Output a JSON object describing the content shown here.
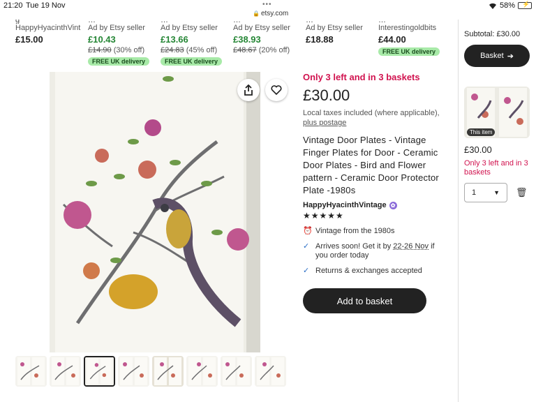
{
  "status": {
    "time": "21:20",
    "date": "Tue 19 Nov",
    "url": "etsy.com",
    "battery": "58%",
    "battery_level": 0.58
  },
  "ads": [
    {
      "cut": "g",
      "seller": "HappyHyacinthVint",
      "price": "£15.00",
      "green": false,
      "orig": "",
      "discount": "",
      "badge": ""
    },
    {
      "cut": "…",
      "seller": "Ad by Etsy seller",
      "price": "£10.43",
      "green": true,
      "orig": "£14.90",
      "discount": "(30% off)",
      "badge": "FREE UK delivery"
    },
    {
      "cut": "…",
      "seller": "Ad by Etsy seller",
      "price": "£13.66",
      "green": true,
      "orig": "£24.83",
      "discount": "(45% off)",
      "badge": "FREE UK delivery"
    },
    {
      "cut": "…",
      "seller": "Ad by Etsy seller",
      "price": "£38.93",
      "green": true,
      "orig": "£48.67",
      "discount": "(20% off)",
      "badge": ""
    },
    {
      "cut": "…",
      "seller": "Ad by Etsy seller",
      "price": "£18.88",
      "green": false,
      "orig": "",
      "discount": "",
      "badge": ""
    },
    {
      "cut": "…",
      "seller": "Interestingoldbits",
      "price": "£44.00",
      "green": false,
      "orig": "",
      "discount": "",
      "badge": "FREE UK delivery"
    }
  ],
  "product": {
    "urgency": "Only 3 left and in 3 baskets",
    "price": "£30.00",
    "taxes": "Local taxes included (where applicable),",
    "postage_link": "plus postage",
    "title": "Vintage Door Plates - Vintage Finger Plates for Door - Ceramic Door Plates - Bird and Flower pattern - Ceramic Door Protector Plate -1980s",
    "shop": "HappyHyacinthVintage",
    "rating_stars": "★★★★★",
    "features": [
      {
        "icon": "alarm-clock-icon",
        "text": "Vintage from the 1980s",
        "link": ""
      },
      {
        "icon": "check-icon",
        "text": "Arrives soon! Get it by ",
        "link": "22-26 Nov",
        "text2": " if you order today"
      },
      {
        "icon": "check-icon",
        "text": "Returns & exchanges accepted",
        "link": ""
      }
    ],
    "add_to_basket": "Add to basket"
  },
  "basket": {
    "subtotal": "Subtotal: £30.00",
    "basket_label": "Basket",
    "this_item": "This item",
    "price": "£30.00",
    "urgency": "Only 3 left and in 3 baskets",
    "quantity": "1"
  },
  "colors": {
    "urgent": "#d1134f",
    "sale_green": "#258635",
    "badge_bg": "#a8eaa8",
    "button_dark": "#222222"
  }
}
